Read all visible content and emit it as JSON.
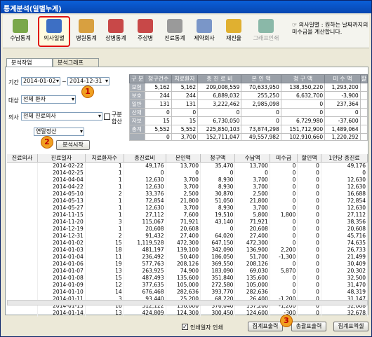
{
  "window": {
    "title": "통계분석(일별누계)"
  },
  "toolbar": {
    "items": [
      {
        "label": "수납통계",
        "name": "toolbar-sunap"
      },
      {
        "label": "의사일별",
        "name": "toolbar-doctor-daily"
      },
      {
        "label": "병원통계",
        "name": "toolbar-hospital"
      },
      {
        "label": "상병통계",
        "name": "toolbar-disease"
      },
      {
        "label": "주상병",
        "name": "toolbar-main-disease"
      },
      {
        "label": "진료통계",
        "name": "toolbar-treatment"
      },
      {
        "label": "제약회사",
        "name": "toolbar-pharma"
      },
      {
        "label": "재진율",
        "name": "toolbar-revisit"
      },
      {
        "label": "그래프인쇄",
        "name": "toolbar-graph-print"
      }
    ],
    "info_line1": "☞ 의사일별 : 원하는 날짜까지의",
    "info_line2": "미수금을 계산합니다."
  },
  "tabs": [
    "분석작업",
    "분석그래프"
  ],
  "filters": {
    "period_label": "기간",
    "date_from": "2014-01-02",
    "tilde": "~",
    "date_to": "2014-12-31",
    "target_label": "대상",
    "target_value": "전체 환자",
    "doctor_label": "의사",
    "doctor_value": "전체 진료의사",
    "split_label1": "구분",
    "split_label2": "합산",
    "settle_value": "연말정산",
    "start_button": "분석시작"
  },
  "markers": [
    "1",
    "2",
    "3"
  ],
  "summary": {
    "headers": [
      "구 분",
      "청구건수",
      "치료환자",
      "총 진 료 비",
      "본 인 액",
      "청 구 액",
      "미 수 액",
      "할"
    ],
    "rows": [
      [
        "보험",
        "5,162",
        "5,162",
        "209,008,559",
        "70,633,950",
        "138,350,220",
        "1,293,200"
      ],
      [
        "보호",
        "244",
        "244",
        "6,889,032",
        "255,250",
        "6,632,700",
        "-3,900"
      ],
      [
        "일반",
        "131",
        "131",
        "3,222,462",
        "2,985,098",
        "0",
        "237,364"
      ],
      [
        "산재",
        "0",
        "0",
        "0",
        "0",
        "0",
        "0"
      ],
      [
        "자보",
        "15",
        "15",
        "6,730,050",
        "0",
        "6,729,980",
        "-37,600"
      ],
      [
        "총계",
        "5,552",
        "5,552",
        "225,850,103",
        "73,874,298",
        "151,712,900",
        "1,489,064"
      ],
      [
        "",
        "0",
        "3,700",
        "152,711,047",
        "49,557,982",
        "102,910,660",
        "1,220,292"
      ]
    ]
  },
  "detail": {
    "headers": [
      "진료의사",
      "진료일자",
      "치료환자수",
      "총진료비",
      "본인액",
      "청구액",
      "수납액",
      "미수금",
      "할인액",
      "1인당 총진료"
    ],
    "rows": [
      [
        "",
        "2014-02-22",
        "1",
        "49,176",
        "13,700",
        "35,470",
        "13,700",
        "0",
        "0",
        "49,176"
      ],
      [
        "",
        "2014-02-25",
        "1",
        "0",
        "0",
        "0",
        "0",
        "0",
        "0",
        "0"
      ],
      [
        "",
        "2014-04-04",
        "1",
        "12,630",
        "3,700",
        "8,930",
        "3,700",
        "0",
        "0",
        "12,630"
      ],
      [
        "",
        "2014-04-22",
        "1",
        "12,630",
        "3,700",
        "8,930",
        "3,700",
        "0",
        "0",
        "12,630"
      ],
      [
        "",
        "2014-05-10",
        "2",
        "33,376",
        "2,500",
        "30,870",
        "2,500",
        "0",
        "0",
        "16,688"
      ],
      [
        "",
        "2014-05-13",
        "1",
        "72,854",
        "21,800",
        "51,050",
        "21,800",
        "0",
        "0",
        "72,854"
      ],
      [
        "",
        "2014-05-27",
        "1",
        "12,630",
        "3,700",
        "8,930",
        "3,700",
        "0",
        "0",
        "12,630"
      ],
      [
        "",
        "2014-11-15",
        "1",
        "27,112",
        "7,600",
        "19,510",
        "5,800",
        "1,800",
        "0",
        "27,112"
      ],
      [
        "",
        "2014-11-20",
        "3",
        "115,067",
        "71,921",
        "43,140",
        "71,921",
        "0",
        "0",
        "38,356"
      ],
      [
        "",
        "2014-12-19",
        "1",
        "20,608",
        "20,608",
        "0",
        "20,608",
        "0",
        "0",
        "20,608"
      ],
      [
        "",
        "2014-12-31",
        "2",
        "91,432",
        "27,400",
        "64,020",
        "27,400",
        "0",
        "0",
        "45,716"
      ],
      [
        "",
        "2014-01-02",
        "15",
        "1,119,528",
        "472,300",
        "647,150",
        "472,300",
        "0",
        "0",
        "74,635"
      ],
      [
        "",
        "2014-01-03",
        "18",
        "481,197",
        "139,100",
        "342,090",
        "136,900",
        "2,200",
        "0",
        "26,733"
      ],
      [
        "",
        "2014-01-04",
        "11",
        "236,492",
        "50,400",
        "186,050",
        "51,700",
        "-1,300",
        "0",
        "21,499"
      ],
      [
        "",
        "2014-01-06",
        "19",
        "577,763",
        "208,126",
        "369,550",
        "208,126",
        "0",
        "0",
        "30,409"
      ],
      [
        "",
        "2014-01-07",
        "13",
        "263,925",
        "74,900",
        "183,090",
        "69,030",
        "5,870",
        "0",
        "20,302"
      ],
      [
        "",
        "2014-01-08",
        "15",
        "487,493",
        "135,600",
        "351,840",
        "135,600",
        "0",
        "0",
        "32,500"
      ],
      [
        "",
        "2014-01-09",
        "12",
        "377,635",
        "105,000",
        "272,580",
        "105,000",
        "0",
        "0",
        "31,470"
      ],
      [
        "",
        "2014-01-10",
        "14",
        "676,468",
        "282,636",
        "393,770",
        "282,636",
        "0",
        "0",
        "48,319"
      ],
      [
        "",
        "2014-01-11",
        "3",
        "93,440",
        "25,200",
        "68,220",
        "26,400",
        "-1,200",
        "0",
        "31,147"
      ],
      [
        "",
        "2014-01-13",
        "16",
        "512,122",
        "136,000",
        "376,040",
        "137,200",
        "-1,200",
        "0",
        "32,008"
      ],
      [
        "",
        "2014-01-14",
        "13",
        "424,809",
        "124,300",
        "300,450",
        "124,600",
        "-300",
        "0",
        "32,678"
      ]
    ]
  },
  "footer": {
    "print_date_label": "인쇄일자 인쇄",
    "btn_summary": "집계표출력",
    "btn_total": "총괄표출력",
    "btn_excel": "집계표엑셀"
  }
}
